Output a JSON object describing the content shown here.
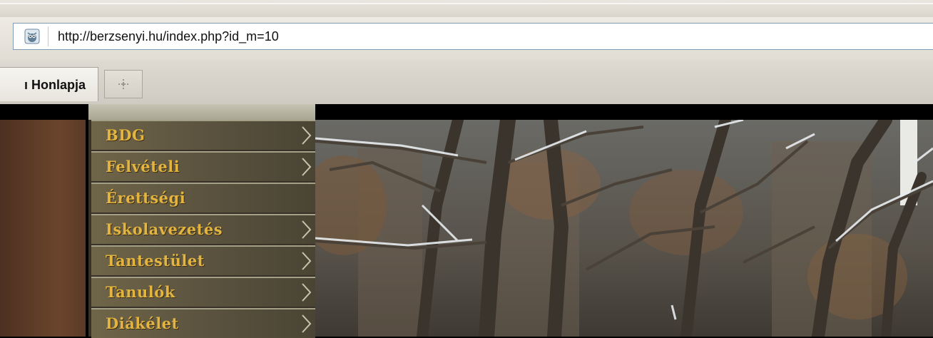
{
  "browser": {
    "url": "http://berzsenyi.hu/index.php?id_m=10",
    "active_tab_title": "ı Honlapja",
    "site_icon": "owl-favicon-icon",
    "new_tab_icon": "new-tab-icon"
  },
  "menu": {
    "items": [
      {
        "label": "BDG",
        "has_submenu": true
      },
      {
        "label": "Felvételi",
        "has_submenu": true
      },
      {
        "label": "Érettségi",
        "has_submenu": false
      },
      {
        "label": "Iskolavezetés",
        "has_submenu": true
      },
      {
        "label": "Tantestület",
        "has_submenu": true
      },
      {
        "label": "Tanulók",
        "has_submenu": true
      },
      {
        "label": "Diákélet",
        "has_submenu": true
      }
    ],
    "text_color": "#e3b43f"
  },
  "photo": {
    "subject": "snowy-trees-photo"
  }
}
